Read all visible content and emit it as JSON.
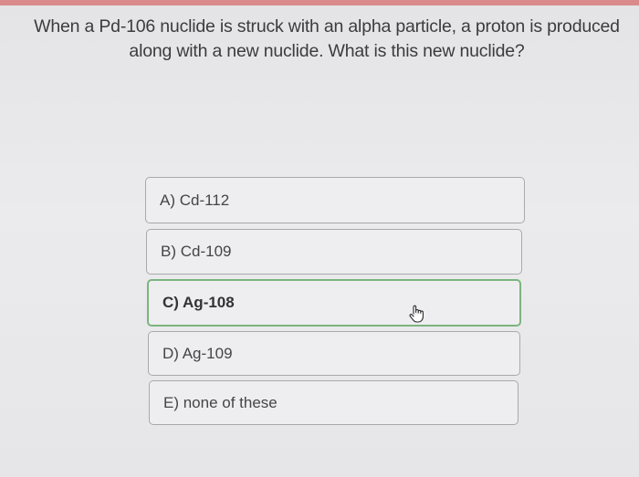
{
  "question": {
    "line1": "When a Pd-106 nuclide is struck with an alpha particle, a proton is produced",
    "line2": "along with a new nuclide. What is this new nuclide?"
  },
  "options": [
    {
      "label": "A) Cd-112",
      "selected": false
    },
    {
      "label": "B) Cd-109",
      "selected": false
    },
    {
      "label": "C) Ag-108",
      "selected": true
    },
    {
      "label": "D) Ag-109",
      "selected": false
    },
    {
      "label": "E) none of these",
      "selected": false
    }
  ],
  "cursor": {
    "icon": "hand-pointer-icon"
  },
  "colors": {
    "top_accent": "#d98b8b",
    "selected_border": "#7bb57e",
    "option_border": "#a9a9ad"
  }
}
